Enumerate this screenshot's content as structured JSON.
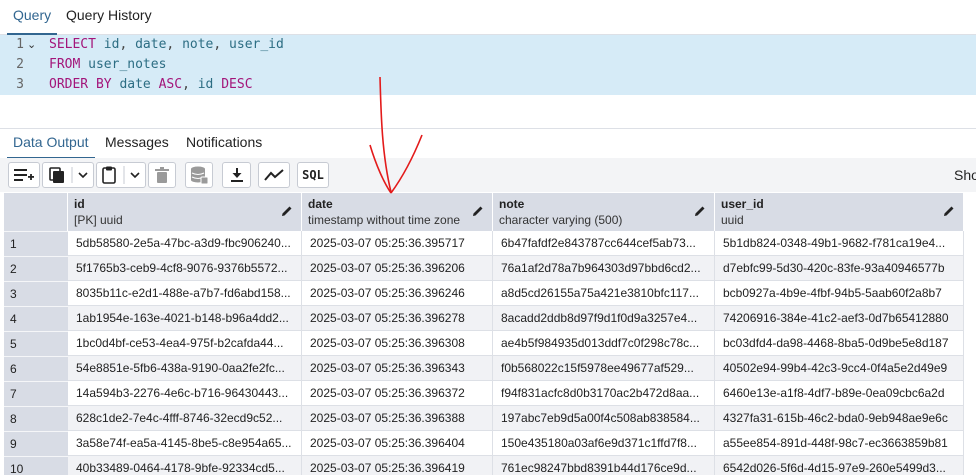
{
  "top_tabs": {
    "query": "Query",
    "history": "Query History"
  },
  "editor": {
    "lines": [
      {
        "num": "1",
        "tokens": [
          {
            "t": "SELECT",
            "c": "kw"
          },
          {
            "t": " ",
            "c": "punc"
          },
          {
            "t": "id",
            "c": "id"
          },
          {
            "t": ", ",
            "c": "punc"
          },
          {
            "t": "date",
            "c": "id"
          },
          {
            "t": ", ",
            "c": "punc"
          },
          {
            "t": "note",
            "c": "id"
          },
          {
            "t": ", ",
            "c": "punc"
          },
          {
            "t": "user_id",
            "c": "id"
          }
        ]
      },
      {
        "num": "2",
        "tokens": [
          {
            "t": "FROM",
            "c": "kw"
          },
          {
            "t": " ",
            "c": "punc"
          },
          {
            "t": "user_notes",
            "c": "id"
          }
        ]
      },
      {
        "num": "3",
        "tokens": [
          {
            "t": "ORDER BY",
            "c": "kw"
          },
          {
            "t": " ",
            "c": "punc"
          },
          {
            "t": "date",
            "c": "id"
          },
          {
            "t": " ",
            "c": "punc"
          },
          {
            "t": "ASC",
            "c": "kw"
          },
          {
            "t": ", ",
            "c": "punc"
          },
          {
            "t": "id",
            "c": "id"
          },
          {
            "t": " ",
            "c": "punc"
          },
          {
            "t": "DESC",
            "c": "kw"
          }
        ]
      }
    ]
  },
  "bottom_tabs": {
    "data_output": "Data Output",
    "messages": "Messages",
    "notifications": "Notifications"
  },
  "toolbar": {
    "sql_label": "SQL",
    "show_text": "Sho"
  },
  "grid": {
    "columns": [
      {
        "name": "id",
        "type": "[PK] uuid"
      },
      {
        "name": "date",
        "type": "timestamp without time zone"
      },
      {
        "name": "note",
        "type": "character varying (500)"
      },
      {
        "name": "user_id",
        "type": "uuid"
      }
    ],
    "rows": [
      [
        "1",
        "5db58580-2e5a-47bc-a3d9-fbc906240...",
        "2025-03-07 05:25:36.395717",
        "6b47fafdf2e843787cc644cef5ab73...",
        "5b1db824-0348-49b1-9682-f781ca19e4..."
      ],
      [
        "2",
        "5f1765b3-ceb9-4cf8-9076-9376b5572...",
        "2025-03-07 05:25:36.396206",
        "76a1af2d78a7b964303d97bbd6cd2...",
        "d7ebfc99-5d30-420c-83fe-93a40946577b"
      ],
      [
        "3",
        "8035b11c-e2d1-488e-a7b7-fd6abd158...",
        "2025-03-07 05:25:36.396246",
        "a8d5cd26155a75a421e3810bfc117...",
        "bcb0927a-4b9e-4fbf-94b5-5aab60f2a8b7"
      ],
      [
        "4",
        "1ab1954e-163e-4021-b148-b96a4dd2...",
        "2025-03-07 05:25:36.396278",
        "8acadd2ddb8d97f9d1f0d9a3257e4...",
        "74206916-384e-41c2-aef3-0d7b65412880"
      ],
      [
        "5",
        "1bc0d4bf-ce53-4ea4-975f-b2cafda44...",
        "2025-03-07 05:25:36.396308",
        "ae4b5f984935d013ddf7c0f298c78c...",
        "bc03dfd4-da98-4468-8ba5-0d9be5e8d187"
      ],
      [
        "6",
        "54e8851e-5fb6-438a-9190-0aa2fe2fc...",
        "2025-03-07 05:25:36.396343",
        "f0b568022c15f5978ee49677af529...",
        "40502e94-99b4-42c3-9cc4-0f4a5e2d49e9"
      ],
      [
        "7",
        "14a594b3-2276-4e6c-b716-96430443...",
        "2025-03-07 05:25:36.396372",
        "f94f831acfc8d0b3170ac2b472d8aa...",
        "6460e13e-a1f8-4df7-b89e-0ea09cbc6a2d"
      ],
      [
        "8",
        "628c1de2-7e4c-4fff-8746-32ecd9c52...",
        "2025-03-07 05:25:36.396388",
        "197abc7eb9d5a00f4c508ab838584...",
        "4327fa31-615b-46c2-bda0-9eb948ae9e6c"
      ],
      [
        "9",
        "3a58e74f-ea5a-4145-8be5-c8e954a65...",
        "2025-03-07 05:25:36.396404",
        "150e435180a03af6e9d371c1ffd7f8...",
        "a55ee854-891d-448f-98c7-ec3663859b81"
      ],
      [
        "10",
        "40b33489-0464-4178-9bfe-92334cd5...",
        "2025-03-07 05:25:36.396419",
        "761ec98247bbd8391b44d176ce9d...",
        "6542d026-5f6d-4d15-97e9-260e5499d3..."
      ]
    ]
  }
}
